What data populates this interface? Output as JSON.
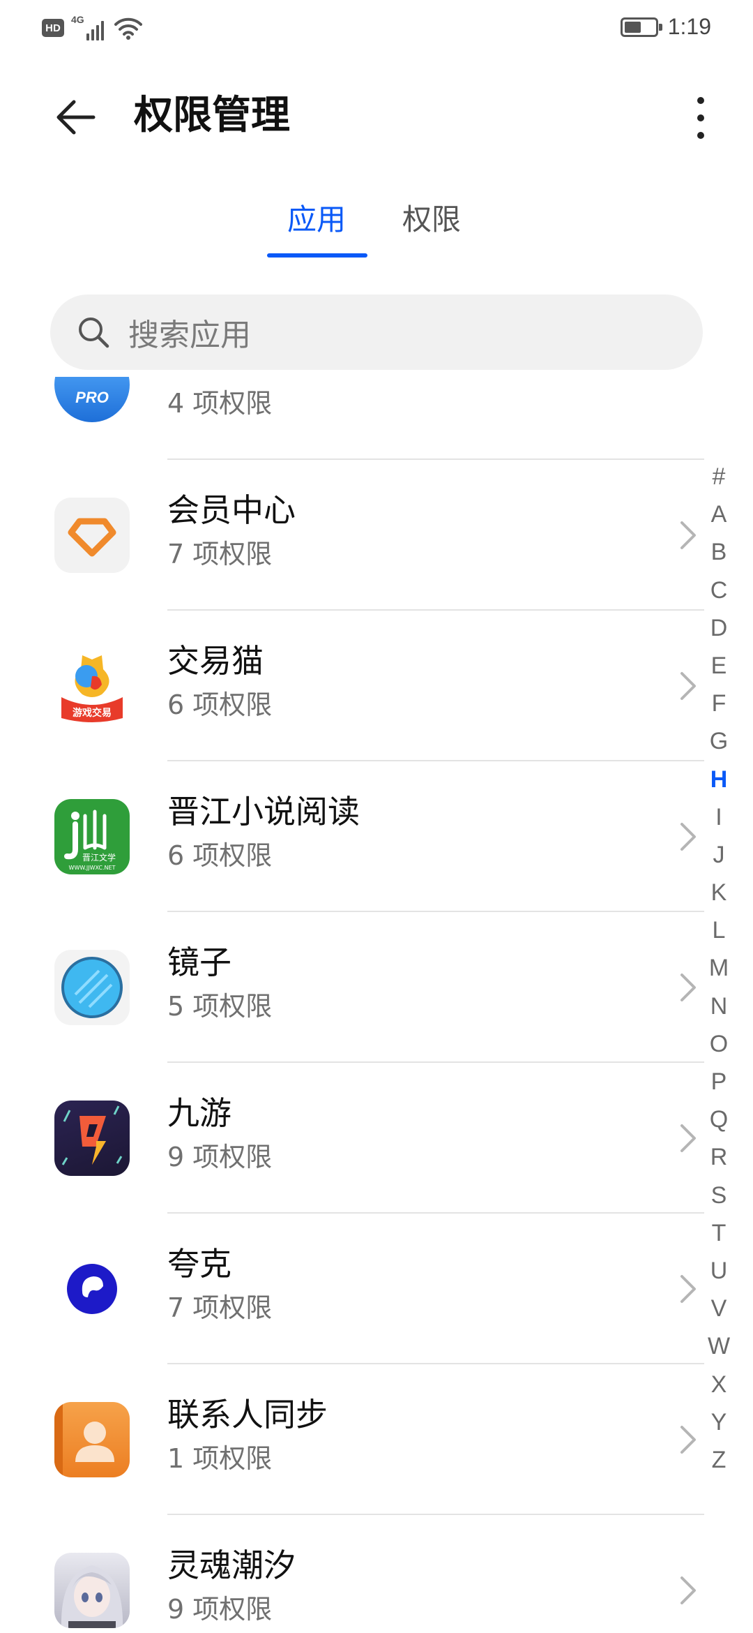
{
  "status_bar": {
    "hd_label": "HD",
    "network_label": "4G",
    "time": "1:19",
    "battery_level": 0.55
  },
  "header": {
    "title": "权限管理"
  },
  "tabs": [
    {
      "label": "应用",
      "active": true
    },
    {
      "label": "权限",
      "active": false
    }
  ],
  "search": {
    "placeholder": "搜索应用"
  },
  "apps": [
    {
      "name": "",
      "permissions": "4 项权限",
      "icon": "pro-app-icon",
      "color": "#2f86e8"
    },
    {
      "name": "会员中心",
      "permissions": "7 项权限",
      "icon": "diamond-icon",
      "color": "#f08a2c"
    },
    {
      "name": "交易猫",
      "permissions": "6 项权限",
      "icon": "jiaoyimao-icon",
      "color": "#e83b2a"
    },
    {
      "name": "晋江小说阅读",
      "permissions": "6 项权限",
      "icon": "jinjiang-icon",
      "color": "#2f9e3a"
    },
    {
      "name": "镜子",
      "permissions": "5 项权限",
      "icon": "mirror-icon",
      "color": "#3fb8f0"
    },
    {
      "name": "九游",
      "permissions": "9 项权限",
      "icon": "jiuyou-icon",
      "color": "#2a1f4a"
    },
    {
      "name": "夸克",
      "permissions": "7 项权限",
      "icon": "quark-icon",
      "color": "#1d1ac8"
    },
    {
      "name": "联系人同步",
      "permissions": "1 项权限",
      "icon": "contact-sync-icon",
      "color": "#f0912e"
    },
    {
      "name": "灵魂潮汐",
      "permissions": "9 项权限",
      "icon": "anime-avatar-icon",
      "color": "#c9c9d3"
    }
  ],
  "icon_texts": {
    "pro_badge": "PRO",
    "jiaoyimao_caption": "游戏交易",
    "jinjiang_caption": "晋江文学",
    "jinjiang_url": "WWW.JJWXC.NET"
  },
  "index_bar": {
    "letters": [
      "#",
      "A",
      "B",
      "C",
      "D",
      "E",
      "F",
      "G",
      "H",
      "I",
      "J",
      "K",
      "L",
      "M",
      "N",
      "O",
      "P",
      "Q",
      "R",
      "S",
      "T",
      "U",
      "V",
      "W",
      "X",
      "Y",
      "Z"
    ],
    "active": "H"
  },
  "colors": {
    "accent": "#0a59f7",
    "background": "#ffffff",
    "search_bg": "#f1f1f1"
  }
}
